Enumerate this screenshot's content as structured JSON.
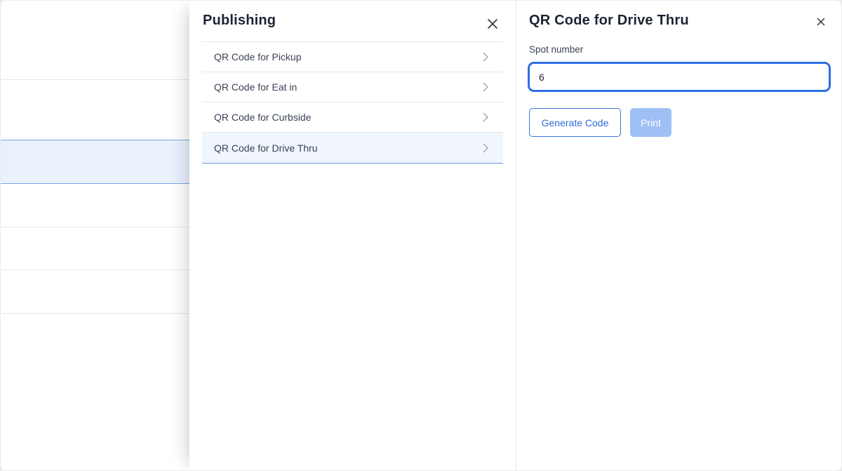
{
  "publishing_panel": {
    "title": "Publishing",
    "close_icon": "close-icon",
    "items": [
      {
        "label": "QR Code for Pickup",
        "icon": "chevron-right-icon",
        "active": false
      },
      {
        "label": "QR Code for Eat in",
        "icon": "chevron-right-icon",
        "active": false
      },
      {
        "label": "QR Code for Curbside",
        "icon": "chevron-right-icon",
        "active": false
      },
      {
        "label": "QR Code for Drive Thru",
        "icon": "chevron-right-icon",
        "active": true
      }
    ]
  },
  "detail_panel": {
    "title": "QR Code for Drive Thru",
    "close_icon": "close-icon",
    "spot_label": "Spot number",
    "spot_value": "6",
    "generate_label": "Generate Code",
    "print_label": "Print"
  },
  "colors": {
    "accent": "#2c6ee6",
    "print_disabled": "#9ec0f5",
    "active_row_bg": "#f1f6fe",
    "bg_selected_row": "#e9f1fd"
  }
}
